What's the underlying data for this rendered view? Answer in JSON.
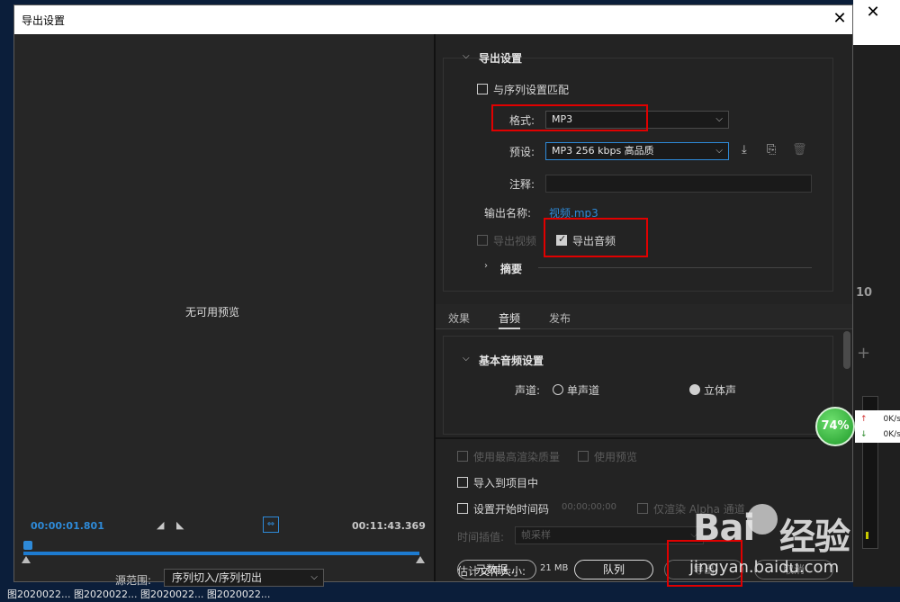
{
  "background_app": {
    "close_glyph": "✕",
    "number": "10",
    "plus": "+",
    "net_up": "0K/s",
    "net_down": "0K/s",
    "up_arrow": "↑",
    "down_arrow": "↓"
  },
  "progress_badge": "74%",
  "taskbar_text": "图2020022... 图2020022... 图2020022... 图2020022...",
  "dialog": {
    "title": "导出设置",
    "close_glyph": "✕",
    "preview": {
      "no_preview": "无可用预览",
      "timecode_start": "00:00:01.801",
      "timecode_end": "00:11:43.369",
      "mark_in": "◢",
      "mark_out": "◣",
      "fit_icon": "⇔",
      "source_range_label": "源范围:",
      "source_range_value": "序列切入/序列切出"
    },
    "export_settings": {
      "header": "导出设置",
      "match_sequence_label": "与序列设置匹配",
      "format_label": "格式:",
      "format_value": "MP3",
      "preset_label": "预设:",
      "preset_value": "MP3 256 kbps 高品质",
      "comments_label": "注释:",
      "comments_value": "",
      "output_name_label": "输出名称:",
      "output_name_value": "视频.mp3",
      "export_video_label": "导出视频",
      "export_audio_label": "导出音频",
      "summary_label": "摘要"
    },
    "tabs": [
      {
        "label": "效果"
      },
      {
        "label": "音频"
      },
      {
        "label": "发布"
      }
    ],
    "audio": {
      "header": "基本音频设置",
      "channels_label": "声道:",
      "mono_label": "单声道",
      "stereo_label": "立体声"
    },
    "bottom": {
      "max_render_quality": "使用最高渲染质量",
      "use_previews": "使用预览",
      "import_into_project": "导入到项目中",
      "set_start_timecode": "设置开始时间码",
      "start_timecode_value": "00;00;00;00",
      "render_alpha_only": "仅渲染 Alpha 通道",
      "time_interpolation_label": "时间插值:",
      "time_interpolation_value": "帧采样",
      "estimated_size_label": "估计文件大小:",
      "estimated_size_value": "21 MB",
      "metadata_button": "元数据...",
      "queue_button": "队列",
      "export_button": "导出",
      "cancel_button": "取消"
    }
  },
  "colors": {
    "accent": "#2e8ad8",
    "highlight_box": "#e00000",
    "panel_bg": "#232323"
  }
}
